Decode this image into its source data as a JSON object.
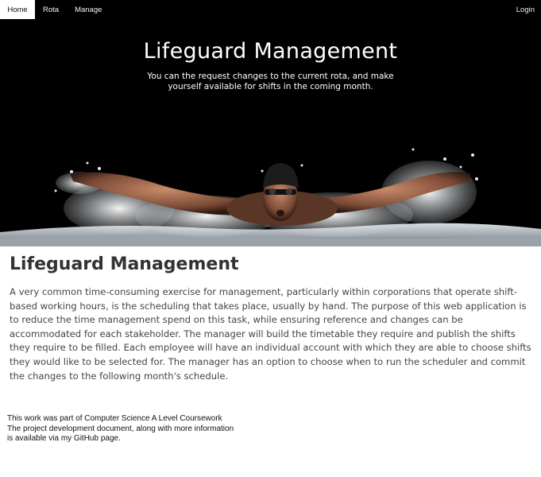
{
  "nav": {
    "home": "Home",
    "rota": "Rota",
    "manage": "Manage",
    "login": "Login"
  },
  "hero": {
    "title": "Lifeguard Management",
    "subtitle": "You can the request changes to the current rota, and make yourself available for shifts in the coming month.",
    "image_icon": "swimmer-butterfly-image"
  },
  "main": {
    "heading": "Lifeguard Management",
    "description": "A very common time-consuming exercise for management, particularly within corporations that operate shift-based working hours, is the scheduling that takes place, usually by hand. The purpose of this web application is to reduce the time management spend on this task, while ensuring reference and changes can be accommodated for each stakeholder. The manager will build the timetable they require and publish the shifts they require to be filled. Each employee will have an individual account with which they are able to choose shifts they would like to be selected for. The manager has an option to choose when to run the scheduler and commit the changes to the following month's schedule."
  },
  "footer": {
    "line1": "This work was part of Computer Science A Level Coursework",
    "line2": "The project development document, along with more information",
    "line3": "is available via my GitHub page."
  },
  "colors": {
    "navbar_bg": "#000000",
    "active_tab_bg": "#ffffff",
    "hero_bg": "#000000",
    "text_body": "#444444"
  }
}
